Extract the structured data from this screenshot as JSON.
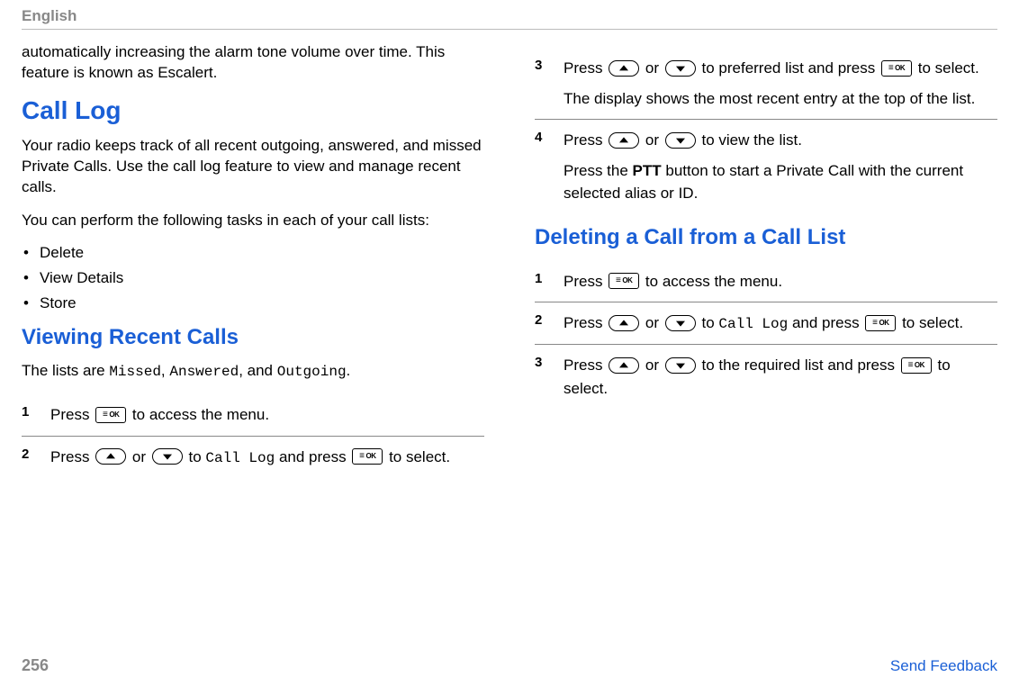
{
  "header": {
    "language": "English"
  },
  "left": {
    "intro_para": "automatically increasing the alarm tone volume over time. This feature is known as Escalert.",
    "heading_call_log": "Call Log",
    "call_log_para1": "Your radio keeps track of all recent outgoing, answered, and missed Private Calls. Use the call log feature to view and manage recent calls.",
    "call_log_para2": "You can perform the following tasks in each of your call lists:",
    "bullets": {
      "b0": "Delete",
      "b1": "View Details",
      "b2": "Store"
    },
    "heading_viewing": "Viewing Recent Calls",
    "viewing_intro_1": "The lists are ",
    "viewing_missed": "Missed",
    "viewing_sep1": ", ",
    "viewing_answered": "Answered",
    "viewing_sep2": ", and ",
    "viewing_outgoing": "Outgoing",
    "viewing_intro_end": ".",
    "steps": {
      "s1": {
        "num": "1",
        "t1": "Press ",
        "t2": " to access the menu."
      },
      "s2": {
        "num": "2",
        "t1": "Press ",
        "t_or": " or ",
        "t_to": " to ",
        "call_log": "Call Log",
        "t_andpress": " and press ",
        "t_end": " to select."
      }
    }
  },
  "right": {
    "steps_cont": {
      "s3": {
        "num": "3",
        "t1": "Press ",
        "t_or": " or ",
        "t2": " to preferred list and press ",
        "t3": " to select.",
        "p2": "The display shows the most recent entry at the top of the list."
      },
      "s4": {
        "num": "4",
        "t1": "Press ",
        "t_or": " or ",
        "t2": " to view the list.",
        "p2a": "Press the ",
        "ptt": "PTT",
        "p2b": " button to start a Private Call with the current selected alias or ID."
      }
    },
    "heading_delete": "Deleting a Call from a Call List",
    "del_steps": {
      "s1": {
        "num": "1",
        "t1": "Press ",
        "t2": " to access the menu."
      },
      "s2": {
        "num": "2",
        "t1": "Press ",
        "t_or": " or ",
        "t_to": " to ",
        "call_log": "Call Log",
        "t_andpress": " and press ",
        "t_end": " to select."
      },
      "s3": {
        "num": "3",
        "t1": "Press ",
        "t_or": " or ",
        "t2": " to the required list and press ",
        "t3": " to select."
      }
    }
  },
  "footer": {
    "page_num": "256",
    "feedback": "Send Feedback"
  },
  "icons": {
    "ok_label": "OK"
  }
}
